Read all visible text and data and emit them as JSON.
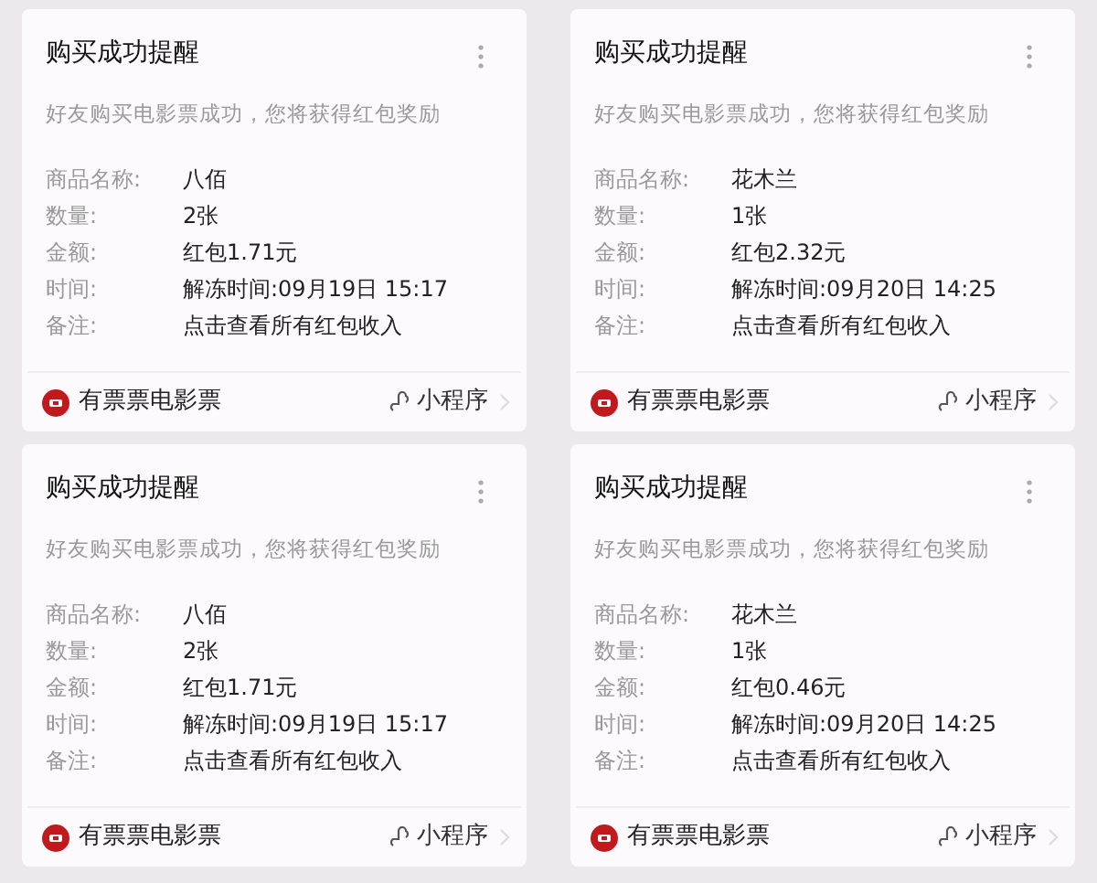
{
  "cards": [
    {
      "title": "购买成功提醒",
      "message": "好友购买电影票成功，您将获得红包奖励",
      "fields": [
        {
          "label": "商品名称:",
          "value": "八佰"
        },
        {
          "label": "数量:",
          "value": "2张"
        },
        {
          "label": "金额:",
          "value": "红包1.71元"
        },
        {
          "label": "时间:",
          "value": "解冻时间:09月19日 15:17"
        },
        {
          "label": "备注:",
          "value": "点击查看所有红包收入"
        }
      ],
      "app_name": "有票票电影票",
      "app_type": "小程序"
    },
    {
      "title": "购买成功提醒",
      "message": "好友购买电影票成功，您将获得红包奖励",
      "fields": [
        {
          "label": "商品名称:",
          "value": "花木兰"
        },
        {
          "label": "数量:",
          "value": "1张"
        },
        {
          "label": "金额:",
          "value": "红包2.32元"
        },
        {
          "label": "时间:",
          "value": "解冻时间:09月20日 14:25"
        },
        {
          "label": "备注:",
          "value": "点击查看所有红包收入"
        }
      ],
      "app_name": "有票票电影票",
      "app_type": "小程序"
    },
    {
      "title": "购买成功提醒",
      "message": "好友购买电影票成功，您将获得红包奖励",
      "fields": [
        {
          "label": "商品名称:",
          "value": "八佰"
        },
        {
          "label": "数量:",
          "value": "2张"
        },
        {
          "label": "金额:",
          "value": "红包1.71元"
        },
        {
          "label": "时间:",
          "value": "解冻时间:09月19日 15:17"
        },
        {
          "label": "备注:",
          "value": "点击查看所有红包收入"
        }
      ],
      "app_name": "有票票电影票",
      "app_type": "小程序"
    },
    {
      "title": "购买成功提醒",
      "message": "好友购买电影票成功，您将获得红包奖励",
      "fields": [
        {
          "label": "商品名称:",
          "value": "花木兰"
        },
        {
          "label": "数量:",
          "value": "1张"
        },
        {
          "label": "金额:",
          "value": "红包0.46元"
        },
        {
          "label": "时间:",
          "value": "解冻时间:09月20日 14:25"
        },
        {
          "label": "备注:",
          "value": "点击查看所有红包收入"
        }
      ],
      "app_name": "有票票电影票",
      "app_type": "小程序"
    }
  ]
}
